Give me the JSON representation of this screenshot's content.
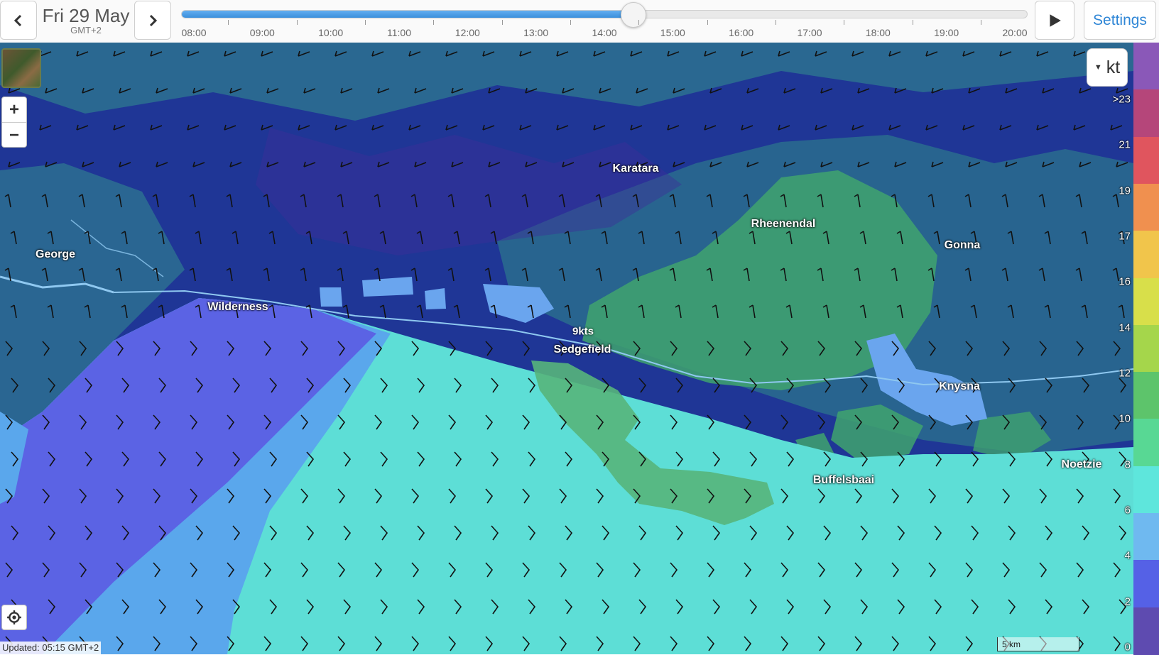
{
  "topbar": {
    "date": "Fri 29 May",
    "timezone": "GMT+2",
    "settings_label": "Settings",
    "hours": [
      "08:00",
      "09:00",
      "10:00",
      "11:00",
      "12:00",
      "13:00",
      "14:00",
      "15:00",
      "16:00",
      "17:00",
      "18:00",
      "19:00",
      "20:00"
    ],
    "timeline_progress": 0.5335
  },
  "map": {
    "unit": "kt",
    "zoom_in": "+",
    "zoom_out": "−",
    "updated": "Updated: 05:15 GMT+2",
    "scale_label": "5 km",
    "wind_label": "9kts",
    "places": {
      "karatara": "Karatara",
      "rheenendal": "Rheenendal",
      "gonna": "Gonna",
      "george": "George",
      "wilderness": "Wilderness",
      "sedgefield": "Sedgefield",
      "knysna": "Knysna",
      "noetzie": "Noetzie",
      "buffelsbaai": "Buffelsbaai"
    }
  },
  "legend": {
    "labels": [
      ">23",
      "21",
      "19",
      "17",
      "16",
      "14",
      "12",
      "10",
      "8",
      "6",
      "4",
      "2",
      "0"
    ],
    "colors": [
      "#8a58b8",
      "#b5467a",
      "#e0555e",
      "#f0904f",
      "#f1c54b",
      "#d8df4a",
      "#a5d64b",
      "#5dc46b",
      "#58d894",
      "#5ee6dc",
      "#6fb9f0",
      "#5561e6",
      "#5e4bb0"
    ]
  }
}
